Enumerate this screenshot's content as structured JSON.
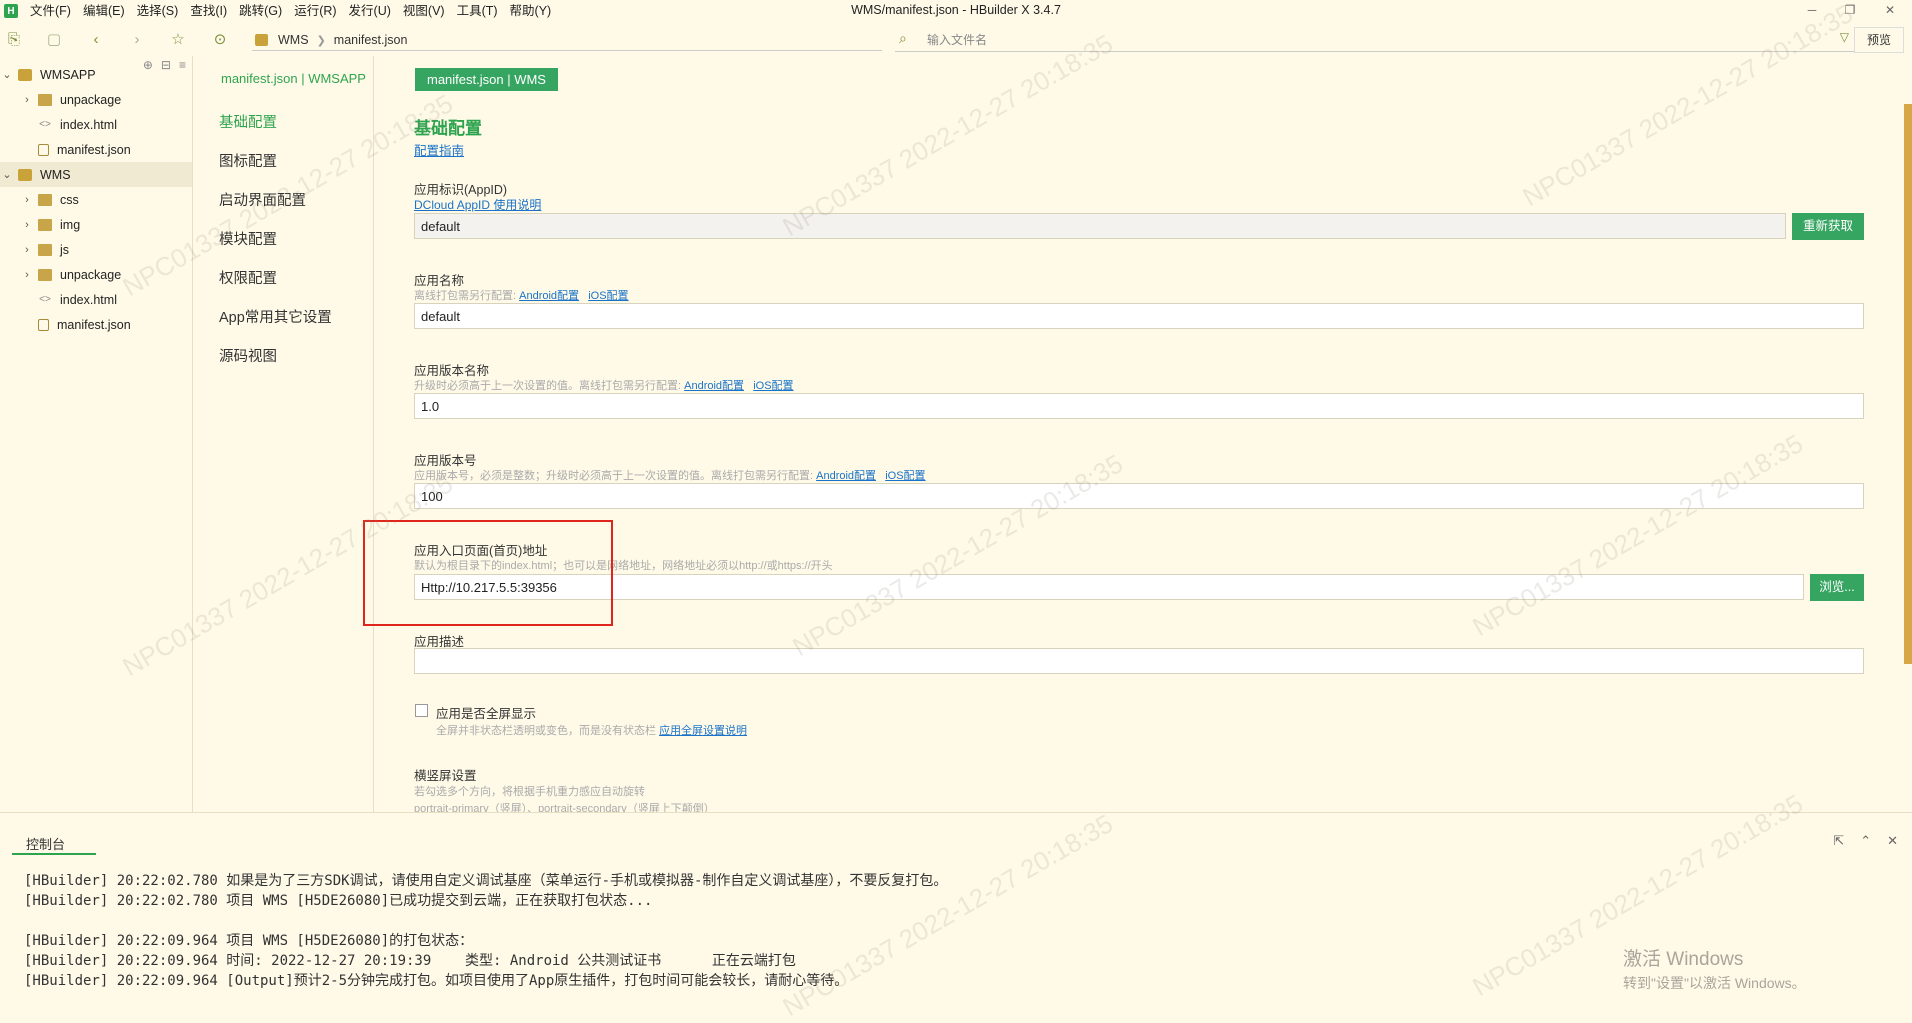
{
  "window": {
    "title": "WMS/manifest.json - HBuilder X 3.4.7",
    "logo": "H"
  },
  "menu": [
    "文件(F)",
    "编辑(E)",
    "选择(S)",
    "查找(I)",
    "跳转(G)",
    "运行(R)",
    "发行(U)",
    "视图(V)",
    "工具(T)",
    "帮助(Y)"
  ],
  "toolbar": {
    "breadcrumb": [
      "WMS",
      "manifest.json"
    ],
    "search_placeholder": "输入文件名",
    "preview_label": "预览"
  },
  "tree": {
    "projects": [
      {
        "name": "WMSAPP",
        "children": [
          "unpackage",
          "index.html",
          "manifest.json"
        ]
      },
      {
        "name": "WMS",
        "children": [
          "css",
          "img",
          "js",
          "unpackage",
          "index.html",
          "manifest.json"
        ]
      }
    ]
  },
  "settings_nav": {
    "file_title": "manifest.json | WMSAPP",
    "items": [
      "基础配置",
      "图标配置",
      "启动界面配置",
      "模块配置",
      "权限配置",
      "App常用其它设置",
      "源码视图"
    ],
    "active": "基础配置"
  },
  "editor": {
    "tab": "manifest.json | WMS",
    "section_title": "基础配置",
    "guide_link": "配置指南",
    "appid": {
      "label": "应用标识(AppID)",
      "link": "DCloud AppID 使用说明",
      "value": "default",
      "button": "重新获取"
    },
    "app_name": {
      "label": "应用名称",
      "hint": "离线打包需另行配置:",
      "link_android": "Android配置",
      "link_ios": "iOS配置",
      "value": "default"
    },
    "version_name": {
      "label": "应用版本名称",
      "hint": "升级时必须高于上一次设置的值。离线打包需另行配置:",
      "link_android": "Android配置",
      "link_ios": "iOS配置",
      "value": "1.0"
    },
    "version_code": {
      "label": "应用版本号",
      "hint": "应用版本号，必须是整数；升级时必须高于上一次设置的值。离线打包需另行配置:",
      "link_android": "Android配置",
      "link_ios": "iOS配置",
      "value": "100"
    },
    "entry_page": {
      "label": "应用入口页面(首页)地址",
      "hint": "默认为根目录下的index.html；也可以是网络地址，网络地址必须以http://或https://开头",
      "value": "Http://10.217.5.5:39356",
      "button": "浏览..."
    },
    "description": {
      "label": "应用描述",
      "value": ""
    },
    "fullscreen": {
      "label": "应用是否全屏显示",
      "hint": "全屏并非状态栏透明或变色，而是没有状态栏",
      "link": "应用全屏设置说明",
      "checked": false
    },
    "orientation": {
      "label": "横竖屏设置",
      "hint": "若勾选多个方向，将根据手机重力感应自动旋转",
      "hint2": "portrait-primary（竖屏）、portrait-secondary（竖屏上下颠倒）"
    }
  },
  "console": {
    "tab": "控制台",
    "lines": [
      "[HBuilder] 20:22:02.780 如果是为了三方SDK调试，请使用自定义调试基座（菜单运行-手机或模拟器-制作自定义调试基座），不要反复打包。",
      "[HBuilder] 20:22:02.780 项目 WMS [H5DE26080]已成功提交到云端，正在获取打包状态...",
      "",
      "[HBuilder] 20:22:09.964 项目 WMS [H5DE26080]的打包状态：",
      "[HBuilder] 20:22:09.964 时间: 2022-12-27 20:19:39    类型: Android 公共测试证书      正在云端打包",
      "[HBuilder] 20:22:09.964 [Output]预计2-5分钟完成打包。如项目使用了App原生插件，打包时间可能会较长，请耐心等待。"
    ]
  },
  "os_notice": {
    "title": "激活 Windows",
    "subtitle": "转到\"设置\"以激活 Windows。"
  },
  "watermark": "NPC01337  2022-12-27  20:18:35"
}
